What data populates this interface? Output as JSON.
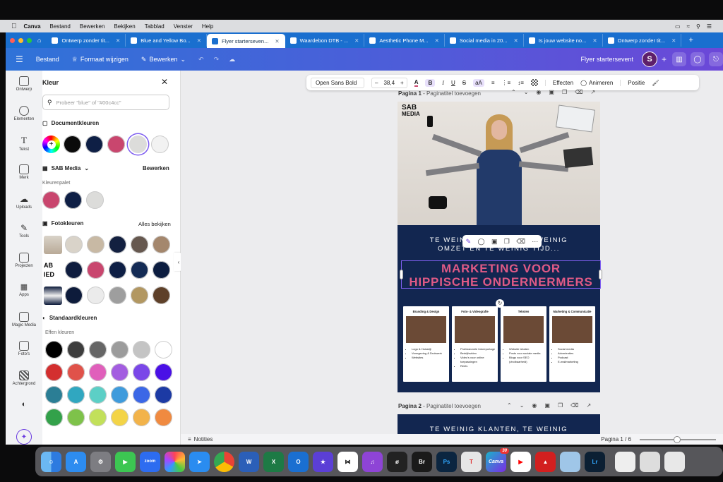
{
  "menubar": {
    "app": "Canva",
    "items": [
      "Bestand",
      "Bewerken",
      "Bekijken",
      "Tabblad",
      "Venster",
      "Help"
    ]
  },
  "tabs": [
    {
      "label": "Ontwerp zonder tit...",
      "active": false
    },
    {
      "label": "Blue and Yellow Bo...",
      "active": false
    },
    {
      "label": "Flyer starterseven...",
      "active": true
    },
    {
      "label": "Waardebon DTB - ...",
      "active": false
    },
    {
      "label": "Aesthetic Phone M...",
      "active": false
    },
    {
      "label": "Social media in 20...",
      "active": false
    },
    {
      "label": "Is jouw website no...",
      "active": false
    },
    {
      "label": "Ontwerp zonder tit...",
      "active": false
    }
  ],
  "toolbar": {
    "bestand": "Bestand",
    "formaat": "Formaat wijzigen",
    "bewerken": "Bewerken",
    "design_title": "Flyer startersevent",
    "avatar": "S"
  },
  "textbar": {
    "font": "Open Sans Bold",
    "size": "38,4",
    "effecten": "Effecten",
    "animeren": "Animeren",
    "positie": "Positie"
  },
  "rail": [
    {
      "label": "Ontwerp",
      "icon": "layout-icon"
    },
    {
      "label": "Elementen",
      "icon": "shapes-icon"
    },
    {
      "label": "Tekst",
      "icon": "text-icon"
    },
    {
      "label": "Merk",
      "icon": "brand-icon"
    },
    {
      "label": "Uploads",
      "icon": "upload-icon"
    },
    {
      "label": "Tools",
      "icon": "pen-icon"
    },
    {
      "label": "Projecten",
      "icon": "folder-icon"
    },
    {
      "label": "Apps",
      "icon": "apps-icon"
    },
    {
      "label": "Magic Media",
      "icon": "magic-media-icon"
    },
    {
      "label": "Foto's",
      "icon": "photo-icon"
    },
    {
      "label": "Achtergrond",
      "icon": "background-icon"
    }
  ],
  "panel": {
    "title": "Kleur",
    "search_placeholder": "Probeer \"blue\" of \"#00c4cc\"",
    "document_colors_label": "Documentkleuren",
    "document_colors": [
      "#0a0a0a",
      "#0e1f45",
      "#c9466e",
      "#dcdcda",
      "#f2f2f2"
    ],
    "brand_name": "SAB Media",
    "brand_edit": "Bewerken",
    "palette_label": "Kleurenpalet",
    "palette_colors": [
      "#c9466e",
      "#0e1f45",
      "#dcdcda"
    ],
    "photo_colors_label": "Fotokleuren",
    "photo_colors_all": "Alles bekijken",
    "photo_rows": [
      [
        "#d9d3c9",
        "#c8b9a4",
        "#132040",
        "#66584f",
        "#a4876d"
      ],
      [
        "#0f1d3f",
        "#c9466e",
        "#0e1f45",
        "#142b55",
        "#0c1d40"
      ],
      [
        "#0d1b3b",
        "#ebebeb",
        "#9e9e9e",
        "#b29761",
        "#5e4029"
      ]
    ],
    "standard_label": "Standaardkleuren",
    "solid_label": "Effen kleuren",
    "solid_rows": [
      [
        "#000000",
        "#3d3d3d",
        "#666666",
        "#9c9c9c",
        "#c4c4c4",
        "#ffffff"
      ],
      [
        "#d32f2f",
        "#e0524a",
        "#e05fbb",
        "#a35de0",
        "#7a47e8",
        "#4a10e6"
      ],
      [
        "#2b7e95",
        "#30a7c0",
        "#5ccfc6",
        "#3f9bdc",
        "#3b67e6",
        "#1c3aa4"
      ],
      [
        "#33a14a",
        "#7ec24a",
        "#c2e05a",
        "#f3d447",
        "#f2b34a",
        "#f08a40"
      ]
    ]
  },
  "canvas": {
    "page1_label": "Pagina 1",
    "page1_title": "Paginatitel toevoegen",
    "page2_label": "Pagina 2",
    "page2_title": "Paginatitel toevoegen",
    "logo_top": "SAB",
    "logo_bottom": "MEDIA",
    "subtitle_l1": "TE WEINIG KLANTEN, TE WEINIG",
    "subtitle_l2": "OMZET EN TE WEINIG TIJD...",
    "headline_l1": "MARKETING VOOR",
    "headline_l2": "HIPPISCHE ONDERNERMERS",
    "page2_text": "TE WEINIG KLANTEN, TE WEINIG",
    "services": [
      {
        "title": "Branding & Design",
        "items": [
          "Logo & Huisstijl",
          "Vormgeving & Drukwerk",
          "Websites"
        ]
      },
      {
        "title": "Foto- & Videografie",
        "items": [
          "Professionele fotoreportage",
          "Bedrijfsvideo",
          "Video's voor online toepassingen",
          "Reels"
        ]
      },
      {
        "title": "Teksten",
        "items": [
          "Website teksten",
          "Posts voor sociale media",
          "Blogs voor SEO (vindbaarheid)"
        ]
      },
      {
        "title": "Marketing & Communicatie",
        "items": [
          "Social media",
          "Advertenties",
          "Podcast",
          "E-mailmarketing"
        ]
      }
    ]
  },
  "footer": {
    "notities": "Notities",
    "page_count": "Pagina 1 / 6"
  },
  "dock_badge": "30"
}
